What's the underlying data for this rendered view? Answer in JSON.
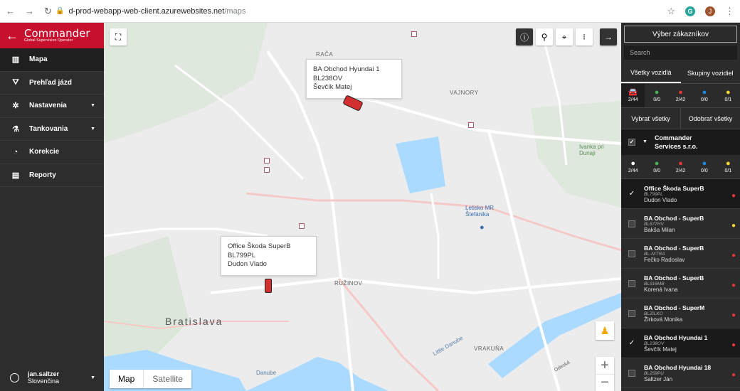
{
  "browser": {
    "url_host": "d-prod-webapp-web-client.azurewebsites.net",
    "url_path": "/maps",
    "profile_initial": "J",
    "extension_letter": "G"
  },
  "brand": {
    "title": "Commander",
    "subtitle": "Global Supervision Operator",
    "color": "#c8102e"
  },
  "menu": [
    {
      "label": "Mapa",
      "icon": "map-icon",
      "active": true
    },
    {
      "label": "Prehľad jázd",
      "icon": "road-icon"
    },
    {
      "label": "Nastavenia",
      "icon": "gear-icon",
      "caret": true
    },
    {
      "label": "Tankovania",
      "icon": "flask-icon",
      "caret": true
    },
    {
      "label": "Korekcie",
      "icon": "gauge-icon"
    },
    {
      "label": "Reporty",
      "icon": "document-icon"
    }
  ],
  "user": {
    "name": "jan.saltzer",
    "language": "Slovenčina"
  },
  "map": {
    "popups": [
      {
        "title": "BA Obchod Hyundai 1",
        "plate": "BL238OV",
        "driver": "Ševčík Matej"
      },
      {
        "title": "Office Škoda SuperB",
        "plate": "BL799PL",
        "driver": "Dudon Vlado"
      }
    ],
    "labels": {
      "raca": "RAČA",
      "vajnory": "VAJNORY",
      "ruzinov": "RUŽINOV",
      "vrakuna": "VRAKUŇA",
      "city": "Bratislava",
      "airport": "Letisko MR Štefánika",
      "ivanka": "Ivanka pri Dunaji",
      "danube": "Danube",
      "little_danube": "Little Danube",
      "odeska": "Odeská"
    },
    "map_type": {
      "map": "Map",
      "satellite": "Satellite"
    },
    "zoom_in": "+",
    "zoom_out": "−"
  },
  "panel": {
    "select_customers": "Výber zákazníkov",
    "search_placeholder": "Search",
    "tabs": [
      "Všetky vozidlá",
      "Skupiny vozidiel"
    ],
    "stats": [
      {
        "value": "2/44",
        "color": "#ffffff"
      },
      {
        "value": "0/0",
        "color": "#4caf50"
      },
      {
        "value": "2/42",
        "color": "#e53935"
      },
      {
        "value": "0/0",
        "color": "#1e88e5"
      },
      {
        "value": "0/1",
        "color": "#fdd835"
      }
    ],
    "select_all": "Vybrať všetky",
    "deselect_all": "Odobrať všetky",
    "group": "Commander Services s.r.o.",
    "group_stats": [
      {
        "value": "2/44",
        "color": "#ffffff"
      },
      {
        "value": "0/0",
        "color": "#4caf50"
      },
      {
        "value": "2/42",
        "color": "#e53935"
      },
      {
        "value": "0/0",
        "color": "#1e88e5"
      },
      {
        "value": "0/1",
        "color": "#fdd835"
      }
    ],
    "vehicles": [
      {
        "title": "Office Škoda SuperB",
        "plate": "BL799PL",
        "driver": "Dudon Vlado",
        "checked": true,
        "color": "#e53935"
      },
      {
        "title": "BA Obchod - SuperB",
        "plate": "BL677HV",
        "driver": "Bakša Milan",
        "checked": false,
        "color": "#fdd835"
      },
      {
        "title": "BA Obchod - SuperB",
        "plate": "BL-NITRA",
        "driver": "Fečko Radoslav",
        "checked": false,
        "color": "#e53935"
      },
      {
        "title": "BA Obchod - SuperB",
        "plate": "BL916MB",
        "driver": "Korená Ivana",
        "checked": false,
        "color": "#e53935"
      },
      {
        "title": "BA Obchod - SuperM",
        "plate": "BLZILKO",
        "driver": "Žirková Monika",
        "checked": false,
        "color": "#e53935"
      },
      {
        "title": "BA Obchod Hyundai 1",
        "plate": "BL238OV",
        "driver": "Ševčík Matej",
        "checked": true,
        "color": "#e53935"
      },
      {
        "title": "BA Obchod Hyundai 18",
        "plate": "BL259PU",
        "driver": "Saltzer Ján",
        "checked": false,
        "color": "#e53935"
      }
    ]
  }
}
